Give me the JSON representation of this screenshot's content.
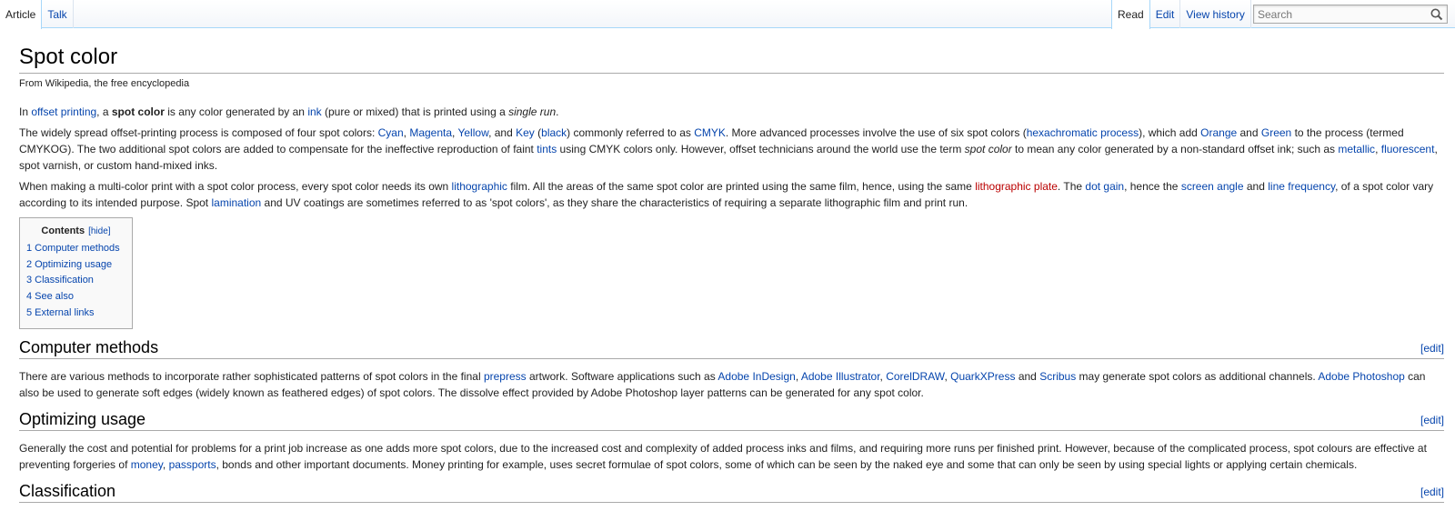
{
  "tabs_left": [
    {
      "label": "Article",
      "selected": true
    },
    {
      "label": "Talk",
      "selected": false
    }
  ],
  "tabs_right": [
    {
      "label": "Read",
      "selected": true
    },
    {
      "label": "Edit",
      "selected": false
    },
    {
      "label": "View history",
      "selected": false
    }
  ],
  "search": {
    "placeholder": "Search",
    "value": "",
    "icon": "magnifier-icon"
  },
  "title": "Spot color",
  "sitesub": "From Wikipedia, the free encyclopedia",
  "intro": {
    "p1": [
      "In ",
      "offset printing",
      ", a ",
      "spot color",
      " is any color generated by an ",
      "ink",
      " (pure or mixed) that is printed using a ",
      "single run",
      "."
    ],
    "p2": [
      "The widely spread offset-printing process is composed of four spot colors: ",
      "Cyan",
      ", ",
      "Magenta",
      ", ",
      "Yellow",
      ", and ",
      "Key",
      " (",
      "black",
      ") commonly referred to as ",
      "CMYK",
      ". More advanced processes involve the use of six spot colors (",
      "hexachromatic process",
      "), which add ",
      "Orange",
      " and ",
      "Green",
      " to the process (termed CMYKOG). The two additional spot colors are added to compensate for the ineffective reproduction of faint ",
      "tints",
      " using CMYK colors only. However, offset technicians around the world use the term ",
      "spot color",
      " to mean any color generated by a non-standard offset ink; such as ",
      "metallic",
      ", ",
      "fluorescent",
      ", spot varnish, or custom hand-mixed inks."
    ],
    "p3": [
      "When making a multi-color print with a spot color process, every spot color needs its own ",
      "lithographic",
      " film. All the areas of the same spot color are printed using the same film, hence, using the same ",
      "lithographic plate",
      ". The ",
      "dot gain",
      ", hence the ",
      "screen angle",
      " and ",
      "line frequency",
      ", of a spot color vary according to its intended purpose. Spot ",
      "lamination",
      " and UV coatings are sometimes referred to as 'spot colors', as they share the characteristics of requiring a separate lithographic film and print run."
    ]
  },
  "toc": {
    "title": "Contents",
    "hide": "[hide]",
    "items": [
      {
        "num": "1",
        "label": "Computer methods"
      },
      {
        "num": "2",
        "label": "Optimizing usage"
      },
      {
        "num": "3",
        "label": "Classification"
      },
      {
        "num": "4",
        "label": "See also"
      },
      {
        "num": "5",
        "label": "External links"
      }
    ]
  },
  "edit_label": "[edit]",
  "sections": {
    "computer_methods": {
      "heading": "Computer methods",
      "p": [
        "There are various methods to incorporate rather sophisticated patterns of spot colors in the final ",
        "prepress",
        " artwork. Software applications such as ",
        "Adobe InDesign",
        ", ",
        "Adobe Illustrator",
        ", ",
        "CorelDRAW",
        ", ",
        "QuarkXPress",
        " and ",
        "Scribus",
        " may generate spot colors as additional channels. ",
        "Adobe Photoshop",
        " can also be used to generate soft edges (widely known as feathered edges) of spot colors. The dissolve effect provided by Adobe Photoshop layer patterns can be generated for any spot color."
      ]
    },
    "optimizing_usage": {
      "heading": "Optimizing usage",
      "p": [
        "Generally the cost and potential for problems for a print job increase as one adds more spot colors, due to the increased cost and complexity of added process inks and films, and requiring more runs per finished print. However, because of the complicated process, spot colours are effective at preventing forgeries of ",
        "money",
        ", ",
        "passports",
        ", bonds and other important documents. Money printing for example, uses secret formulae of spot colors, some of which can be seen by the naked eye and some that can only be seen by using special lights or applying certain chemicals."
      ]
    },
    "classification": {
      "heading": "Classification"
    }
  },
  "colors": {
    "link": "#0645ad",
    "redlink": "#ba0000",
    "tab_border": "#a7d7f9",
    "rule": "#aaaaaa"
  }
}
